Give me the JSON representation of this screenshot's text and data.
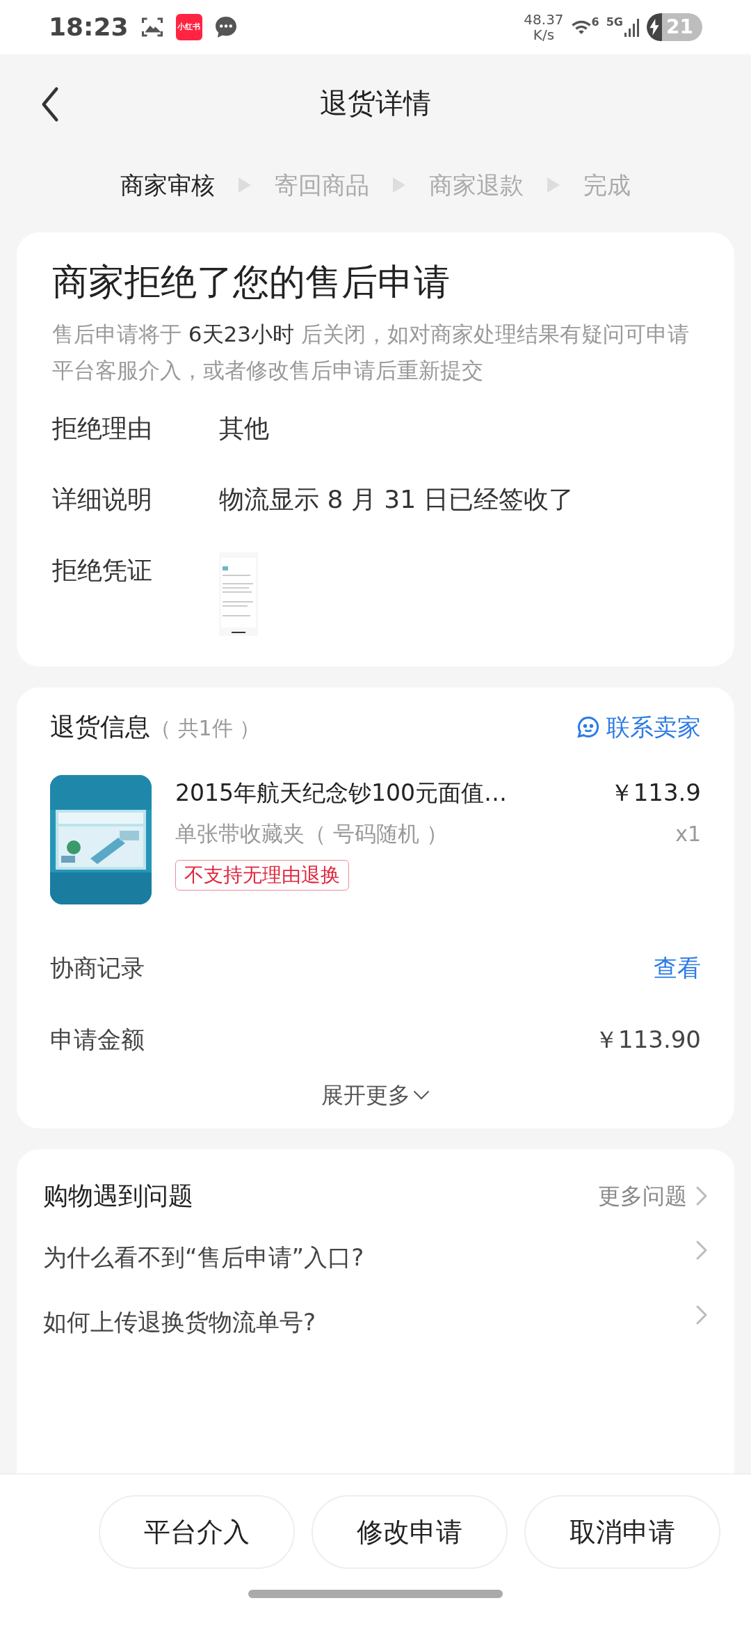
{
  "status_bar": {
    "time": "18:23",
    "app_badge": "小红书",
    "net_speed": "48.37",
    "net_unit": "K/s",
    "wifi_label": "6",
    "signal_label": "5G",
    "battery": "21",
    "charging": true
  },
  "header": {
    "title": "退货详情"
  },
  "steps": [
    {
      "label": "商家审核",
      "selected": true
    },
    {
      "label": "寄回商品",
      "selected": false
    },
    {
      "label": "商家退款",
      "selected": false
    },
    {
      "label": "完成",
      "selected": false
    }
  ],
  "status_card": {
    "title": "商家拒绝了您的售后申请",
    "description": "售后申请将于 **6天23小时** 后关闭，如对商家处理结果有疑问可申请平台客服介入，或者修改售后申请后重新提交",
    "fields": [
      {
        "label": "拒绝理由",
        "value": "其他",
        "kind": "text"
      },
      {
        "label": "详细说明",
        "value": "物流显示 8 月 31 日已经签收了",
        "kind": "text"
      },
      {
        "label": "拒绝凭证"
      }
    ]
  },
  "return_info": {
    "title": "退货信息",
    "count": "（ 共1件 ）",
    "contact": "联系卖家",
    "product": {
      "name": "2015年航天纪念钞100元面值…",
      "price": "￥113.9",
      "variant": "单张带收藏夹（ 号码随机 ）",
      "quantity": "x1",
      "tag": "不支持无理由退换"
    },
    "rows": [
      {
        "label": "协商记录",
        "value": "查看",
        "kind": "link"
      },
      {
        "label": "申请金额",
        "value": "￥113.90",
        "kind": "text"
      }
    ],
    "expand": "展开更多"
  },
  "faq": {
    "title": "购物遇到问题",
    "more": "更多问题",
    "questions": [
      "为什么看不到“售后申请”入口?",
      "如何上传退换货物流单号?"
    ]
  },
  "actions": [
    "平台介入",
    "修改申请",
    "取消申请"
  ]
}
